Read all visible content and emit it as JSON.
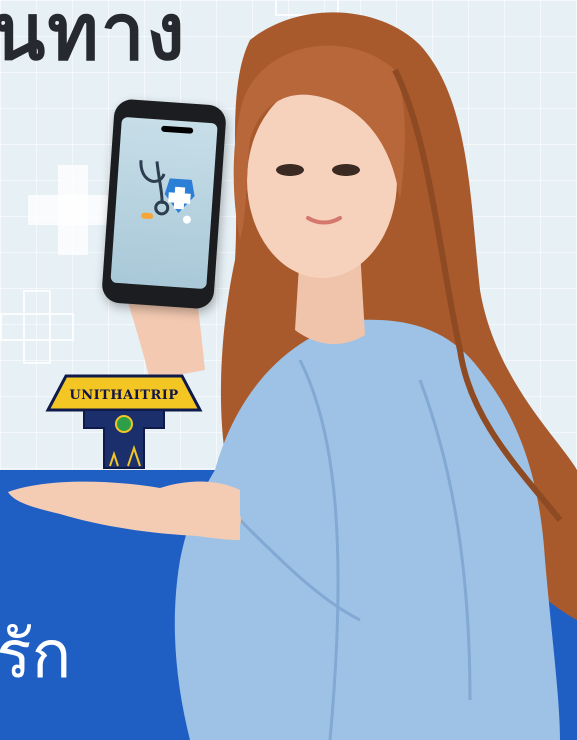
{
  "headline": "นทาง",
  "subline": "รัก",
  "logo": {
    "text": "UNITHAITRIP"
  },
  "icons": [
    "medical-cross-icon",
    "stethoscope-icon",
    "pill-icon",
    "globe-icon"
  ],
  "colors": {
    "background": "#e6f0f5",
    "band": "#1f5fc4",
    "headline": "#262a2e",
    "gown": "#9ec2e6",
    "hair": "#a85a2c",
    "logo_yellow": "#f3c623",
    "logo_navy": "#1a2f6b"
  }
}
